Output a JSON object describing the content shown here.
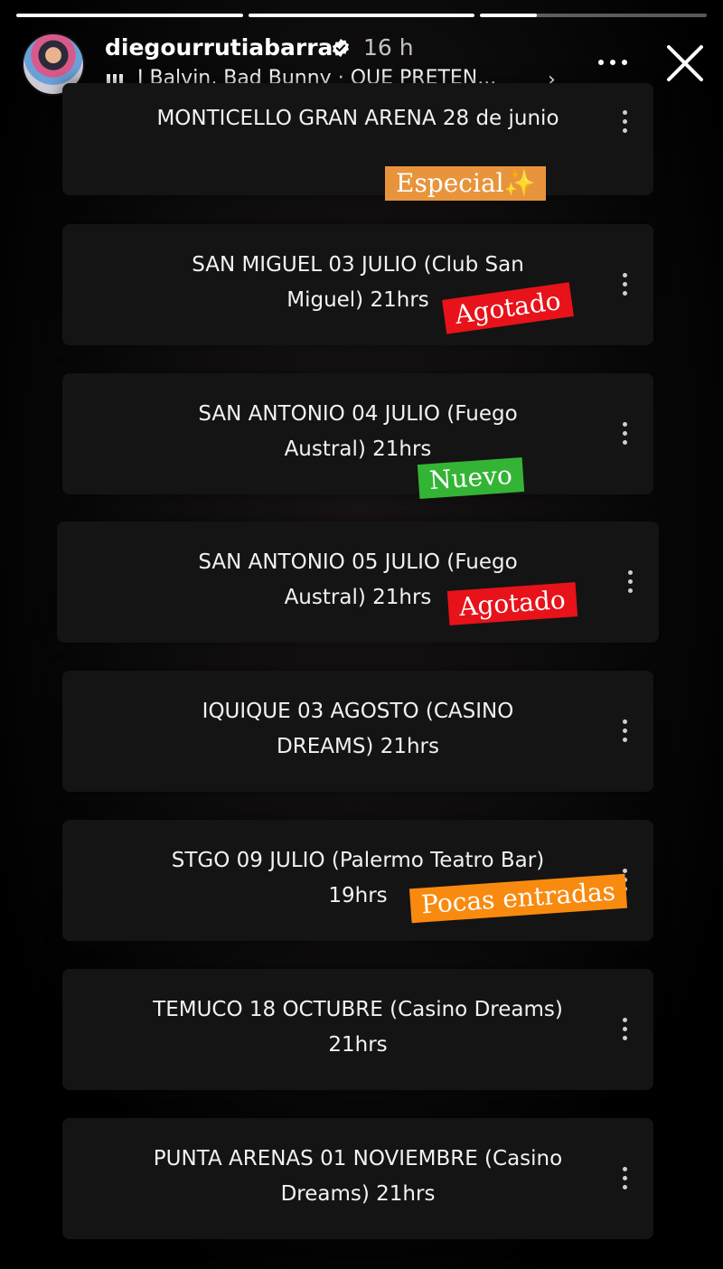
{
  "header": {
    "username": "diegourrutiabarra",
    "time": "16 h",
    "music": {
      "artists": "J Balvin, Bad Bunny",
      "separator": " · ",
      "song": "QUE PRETEN..."
    },
    "progress": [
      1.0,
      1.0,
      0.25
    ]
  },
  "colors": {
    "especial": "#e8943c",
    "agotado": "#e8121a",
    "nuevo": "#34b435",
    "pocas": "#f98a10"
  },
  "events": [
    {
      "text": "MONTICELLO GRAN ARENA 28 de junio",
      "sticker": "Especial✨",
      "sticker_type": "especial"
    },
    {
      "text": "SAN MIGUEL 03 JULIO (Club San Miguel) 21hrs",
      "sticker": "Agotado",
      "sticker_type": "agotado"
    },
    {
      "text": "SAN ANTONIO 04 JULIO (Fuego Austral) 21hrs",
      "sticker": "Nuevo",
      "sticker_type": "nuevo"
    },
    {
      "text": "SAN ANTONIO 05 JULIO (Fuego Austral) 21hrs",
      "sticker": "Agotado",
      "sticker_type": "agotado"
    },
    {
      "text": "IQUIQUE 03 AGOSTO (CASINO DREAMS) 21hrs",
      "sticker": null
    },
    {
      "text": "STGO 09 JULIO (Palermo Teatro Bar) 19hrs",
      "sticker": "Pocas entradas",
      "sticker_type": "pocas"
    },
    {
      "text": "TEMUCO 18 OCTUBRE (Casino Dreams) 21hrs",
      "sticker": null
    },
    {
      "text": "PUNTA ARENAS 01 NOVIEMBRE (Casino Dreams) 21hrs",
      "sticker": null
    }
  ]
}
